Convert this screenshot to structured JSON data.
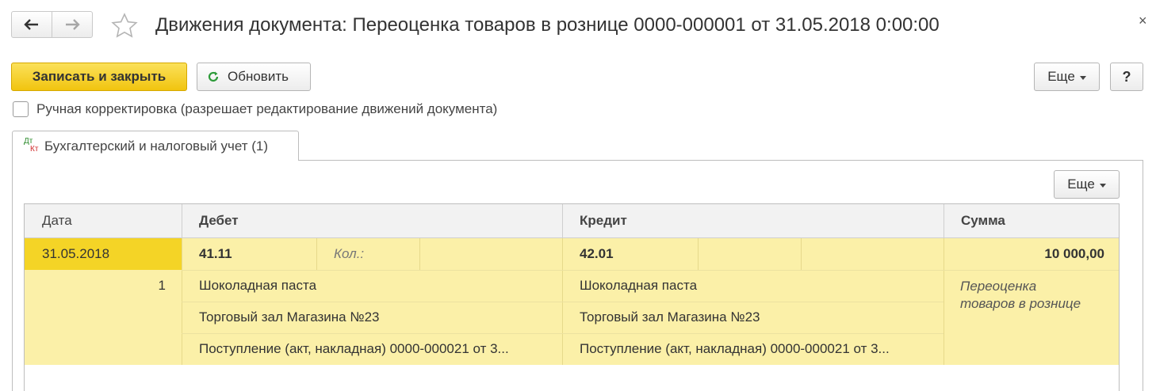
{
  "window": {
    "title": "Движения документа: Переоценка товаров в рознице 0000-000001 от 31.05.2018 0:00:00",
    "close_label": "×",
    "nav_back_icon": "arrow-left-icon",
    "nav_forward_icon": "arrow-right-icon",
    "favorite_icon": "star-icon"
  },
  "toolbar": {
    "save_close_label": "Записать и закрыть",
    "refresh_label": "Обновить",
    "more_label": "Еще",
    "help_label": "?"
  },
  "manual_adjust": {
    "label": "Ручная корректировка (разрешает редактирование движений документа)",
    "checked": false
  },
  "tabs": [
    {
      "icon_top": "Дт",
      "icon_bottom": "Кт",
      "label": "Бухгалтерский и налоговый учет (1)"
    }
  ],
  "table_toolbar": {
    "more_label": "Еще"
  },
  "table": {
    "columns": {
      "date": "Дата",
      "debit": "Дебет",
      "credit": "Кредит",
      "sum": "Сумма"
    },
    "rows": [
      {
        "date": "31.05.2018",
        "number": "1",
        "debit_account": "41.11",
        "debit_qty_label": "Кол.:",
        "credit_account": "42.01",
        "sum": "10 000,00",
        "debit_subconto": [
          "Шоколадная паста",
          "Торговый зал Магазина №23",
          "Поступление (акт, накладная) 0000-000021 от 3..."
        ],
        "credit_subconto": [
          "Шоколадная паста",
          "Торговый зал Магазина №23",
          "Поступление (акт, накладная) 0000-000021 от 3..."
        ],
        "content_line1": "Переоценка",
        "content_line2": "товаров в рознице"
      }
    ]
  },
  "colors": {
    "primary_button": "#f4d426",
    "row_highlight": "#fbf0a8",
    "selected_cell": "#f4d426",
    "refresh_icon": "#2e9b3a"
  }
}
